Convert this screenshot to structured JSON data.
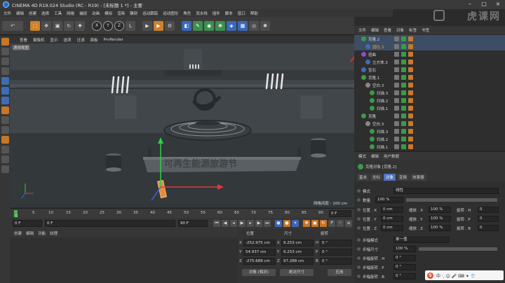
{
  "window": {
    "title": "CINEMA 4D R19.024 Studio (RC - R19) - [未标题 1 *] - 主要",
    "minimize": "–",
    "maximize": "□",
    "close": "×"
  },
  "menu": [
    "文件",
    "编辑",
    "创建",
    "选择",
    "工具",
    "网格",
    "捕捉",
    "动画",
    "模拟",
    "渲染",
    "雕刻",
    "运动跟踪",
    "运动图形",
    "角色",
    "流水线",
    "插件",
    "脚本",
    "窗口",
    "帮助"
  ],
  "toolbar": {
    "undo": "↶",
    "axes": [
      "X",
      "Y",
      "Z"
    ],
    "coord": "L"
  },
  "viewport": {
    "menu": [
      "查看",
      "摄像机",
      "显示",
      "选项",
      "过滤",
      "面板",
      "ProRender"
    ],
    "label": "透视视图",
    "grid_text": "网格间距 : 100 cm",
    "scene_text": "可再生能源旅游节"
  },
  "timeline": {
    "ticks": [
      "0",
      "5",
      "10",
      "15",
      "20",
      "25",
      "30",
      "35",
      "40",
      "45",
      "50",
      "55",
      "60",
      "65",
      "70",
      "75",
      "80",
      "85",
      "90"
    ],
    "end_label": "0 F",
    "start_field": "0 F",
    "current_field": "0 F",
    "range_end": "90 F",
    "max_field": "90 F"
  },
  "material": {
    "menu": [
      "创建",
      "编辑",
      "功能",
      "纹理"
    ]
  },
  "coordinates": {
    "headers": [
      "位置",
      "尺寸",
      "旋转"
    ],
    "rows": [
      {
        "axis": "X",
        "pos": "-252.975 cm",
        "size": "9.253 cm",
        "rot_label": "H",
        "rot": "0 °"
      },
      {
        "axis": "Y",
        "pos": "54.937 cm",
        "size": "9.253 cm",
        "rot_label": "P",
        "rot": "0 °"
      },
      {
        "axis": "Z",
        "pos": "-275.689 cm",
        "size": "97.288 cm",
        "rot_label": "B",
        "rot": "0 °"
      }
    ],
    "mode": "对象 (相对)",
    "size_mode": "绝对尺寸",
    "apply": "应用"
  },
  "object_manager": {
    "tabs": [
      "文件",
      "编辑",
      "查看",
      "对象",
      "标签",
      "书签"
    ],
    "rows": [
      {
        "name": "克隆.2",
        "indent": 1,
        "icon": "#3b9a4a",
        "selected": true,
        "highlight": false
      },
      {
        "name": "圆柱.3",
        "indent": 2,
        "icon": "#3e6db6",
        "selected": true,
        "highlight": true
      },
      {
        "name": "扭曲",
        "indent": 1,
        "icon": "#8c4fc0",
        "selected": false,
        "highlight": false
      },
      {
        "name": "立方体.3",
        "indent": 2,
        "icon": "#3e6db6",
        "selected": false,
        "highlight": false
      },
      {
        "name": "宝石",
        "indent": 1,
        "icon": "#3e6db6",
        "selected": false,
        "highlight": false
      },
      {
        "name": "克隆.1",
        "indent": 1,
        "icon": "#3b9a4a",
        "selected": false,
        "highlight": false
      },
      {
        "name": "空白.3",
        "indent": 2,
        "icon": "#888888",
        "selected": false,
        "highlight": false
      },
      {
        "name": "扫描.3",
        "indent": 3,
        "icon": "#3b9a4a",
        "selected": false,
        "highlight": false
      },
      {
        "name": "扫描.2",
        "indent": 3,
        "icon": "#3b9a4a",
        "selected": false,
        "highlight": false
      },
      {
        "name": "扫描.1",
        "indent": 3,
        "icon": "#3b9a4a",
        "selected": false,
        "highlight": false
      },
      {
        "name": "克隆",
        "indent": 1,
        "icon": "#3b9a4a",
        "selected": false,
        "highlight": false
      },
      {
        "name": "空白.3",
        "indent": 2,
        "icon": "#888888",
        "selected": false,
        "highlight": false
      },
      {
        "name": "扫描.3",
        "indent": 3,
        "icon": "#3b9a4a",
        "selected": false,
        "highlight": false
      },
      {
        "name": "扫描.2",
        "indent": 3,
        "icon": "#3b9a4a",
        "selected": false,
        "highlight": false
      },
      {
        "name": "扫描.1",
        "indent": 3,
        "icon": "#3b9a4a",
        "selected": false,
        "highlight": false
      }
    ]
  },
  "attributes": {
    "tabs": [
      "模式",
      "编辑",
      "用户数据"
    ],
    "object_title": "克隆对象 [克隆.2]",
    "subtabs": [
      "基本",
      "坐标",
      "对象",
      "变换",
      "效果器"
    ],
    "active_subtab": "对象",
    "mode_label": "模式",
    "mode_value": "线性",
    "count_label": "数量",
    "count_value": "100 %",
    "pos_rows": [
      {
        "label": "位置 . X",
        "value": "0 cm",
        "scale_label": "缩放 . X",
        "scale": "100 %",
        "rot_label": "旋转 . H",
        "rot": "0"
      },
      {
        "label": "位置 . Y",
        "value": "0 cm",
        "scale_label": "缩放 . Y",
        "scale": "100 %",
        "rot_label": "旋转 . P",
        "rot": "0"
      },
      {
        "label": "位置 . Z",
        "value": "0 cm",
        "scale_label": "缩放 . Z",
        "scale": "100 %",
        "rot_label": "旋转 . B",
        "rot": "0"
      }
    ],
    "step_mode_label": "步幅模式",
    "step_mode_value": "单一值",
    "step_size_label": "步幅尺寸",
    "step_size_value": "100 %",
    "step_rot_rows": [
      {
        "label": "步幅旋转 . H",
        "value": "0 °"
      },
      {
        "label": "步幅旋转 . P",
        "value": "0 °"
      },
      {
        "label": "步幅旋转 . B",
        "value": "0 °"
      }
    ]
  },
  "watermark": "虎课网",
  "ime": {
    "logo": "S",
    "text": "中 ·, ☺ 🎤 ⌨ ✦ 👕"
  }
}
